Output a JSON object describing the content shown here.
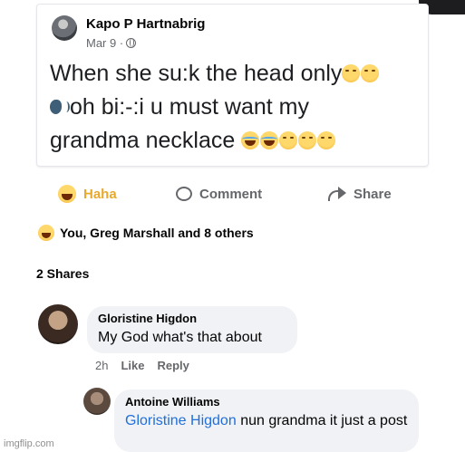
{
  "post": {
    "author": "Kapo P Hartnabrig",
    "date": "Mar 9 ·",
    "line1": "When she su:k the head only",
    "line2": "oh bi:-:i u must want my",
    "line3": "grandma necklace"
  },
  "actions": {
    "haha": "Haha",
    "comment": "Comment",
    "share": "Share"
  },
  "reactions": {
    "summary": "You, Greg Marshall and 8 others"
  },
  "shares": {
    "count": "2 Shares"
  },
  "comments": [
    {
      "author": "Gloristine Higdon",
      "text": "My God what's that about",
      "time": "2h",
      "like": "Like",
      "reply": "Reply"
    },
    {
      "author": "Antoine Williams",
      "mention": "Gloristine Higdon",
      "text": "nun grandma it just a post"
    }
  ],
  "watermark": "imgflip.com",
  "icons": [
    "globe-icon",
    "smirk-emoji-icon",
    "speaking-head-icon",
    "laughing-emoji-icon",
    "haha-icon",
    "comment-icon",
    "share-icon"
  ],
  "colors": {
    "haha": "#e8a92c",
    "mention": "#216fdb",
    "muted": "#65676b",
    "bubble": "#f0f2f5"
  }
}
